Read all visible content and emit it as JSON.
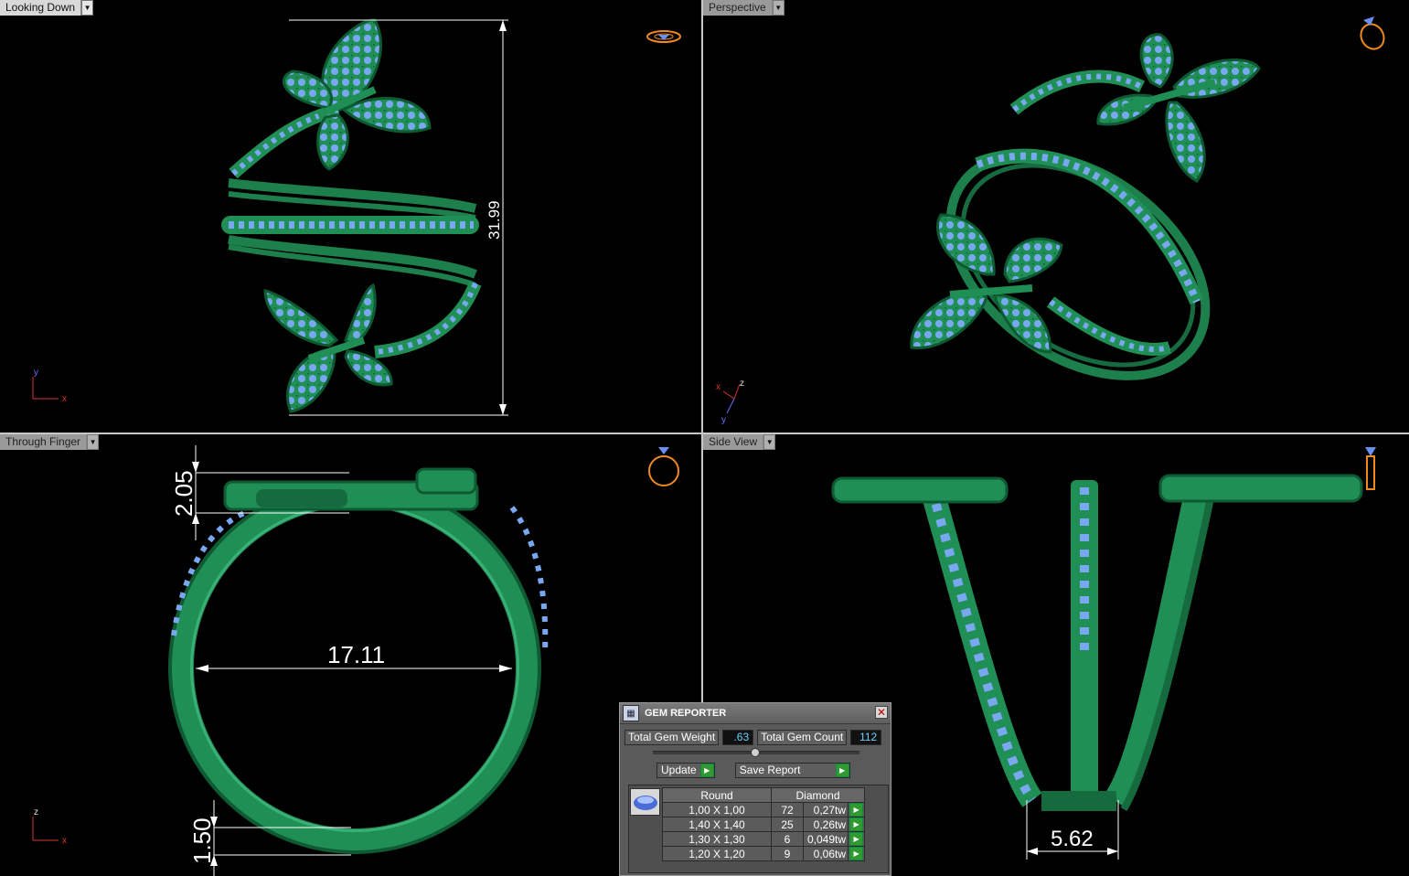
{
  "viewports": {
    "top_left": {
      "label": "Looking Down",
      "dimension": "31.99"
    },
    "top_right": {
      "label": "Perspective"
    },
    "bottom_left": {
      "label": "Through Finger",
      "dim_top": "2.05",
      "dim_width": "17.11",
      "dim_bottom": "1.50"
    },
    "bottom_right": {
      "label": "Side View",
      "dimension": "5.62"
    }
  },
  "axes": {
    "top_left": {
      "a": "y",
      "b": "x"
    },
    "top_right": {
      "a": "x",
      "b": "z",
      "c": "y"
    },
    "bottom_left": {
      "a": "z",
      "b": "x"
    }
  },
  "gem_reporter": {
    "title": "GEM REPORTER",
    "total_weight_label": "Total Gem Weight",
    "total_weight_value": ".63",
    "total_count_label": "Total Gem Count",
    "total_count_value": "112",
    "update_label": "Update",
    "save_label": "Save Report",
    "table": {
      "header_shape": "Round",
      "header_type": "Diamond",
      "rows": [
        {
          "size": "1,00 X 1,00",
          "count": "72",
          "weight": "0,27tw"
        },
        {
          "size": "1,40 X 1,40",
          "count": "25",
          "weight": "0,26tw"
        },
        {
          "size": "1,30 X 1,30",
          "count": "6",
          "weight": "0,049tw"
        },
        {
          "size": "1,20 X 1,20",
          "count": "9",
          "weight": "0,06tw"
        }
      ]
    }
  },
  "colors": {
    "metal": "#1f8f55",
    "metal_dark": "#0d5a33",
    "stone": "#7aa8f0",
    "background": "#000000",
    "nav_icon": "#f08a1e"
  }
}
